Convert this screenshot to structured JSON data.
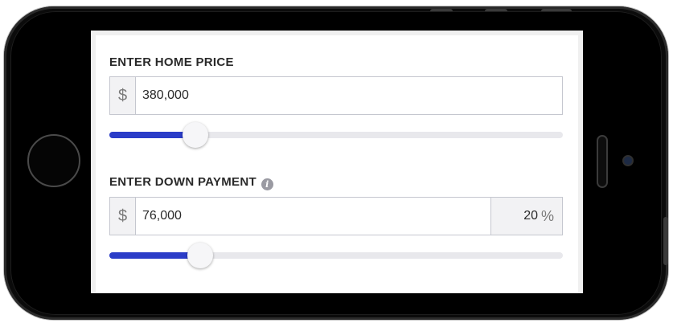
{
  "home_price": {
    "label": "ENTER HOME PRICE",
    "currency_symbol": "$",
    "value": "380,000",
    "slider_fraction": 0.19
  },
  "down_payment": {
    "label": "ENTER DOWN PAYMENT",
    "info_icon": "info-icon",
    "currency_symbol": "$",
    "value": "76,000",
    "percent_value": "20",
    "percent_symbol": "%",
    "slider_fraction": 0.2
  },
  "colors": {
    "slider_fill": "#2b3dc8",
    "slider_track": "#e8e8ec"
  }
}
